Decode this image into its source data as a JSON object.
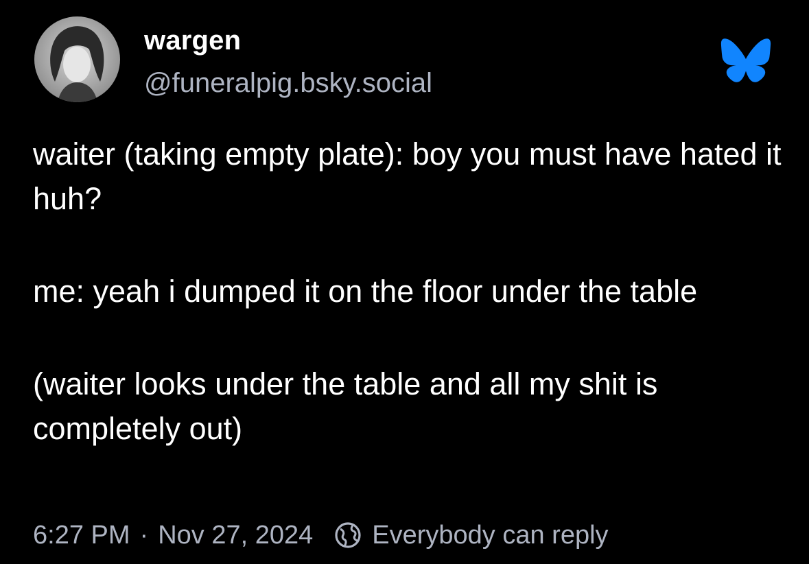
{
  "post": {
    "author": {
      "display_name": "wargen",
      "handle": "@funeralpig.bsky.social",
      "avatar_icon": "avatar-image"
    },
    "logo_icon": "bluesky-butterfly-icon",
    "paragraphs": [
      "waiter (taking empty plate): boy you must have hated it huh?",
      "me: yeah i dumped it on the floor under the table",
      "(waiter looks under the table and all my shit is completely out)"
    ],
    "footer": {
      "time": "6:27 PM",
      "separator": "·",
      "date": "Nov 27, 2024",
      "reply_icon": "globe-icon",
      "reply_setting": "Everybody can reply"
    }
  },
  "colors": {
    "background": "#000000",
    "text": "#ffffff",
    "muted": "#aeb4c2",
    "brand": "#1185fe"
  }
}
